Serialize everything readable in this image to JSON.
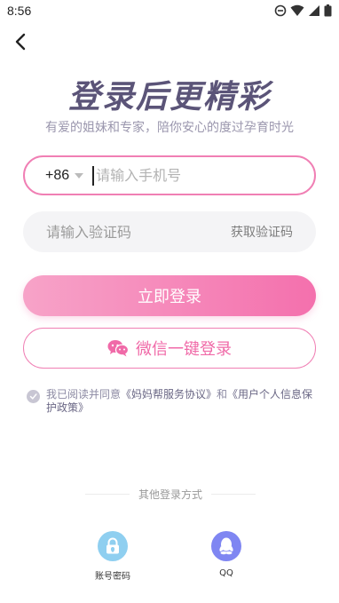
{
  "status_bar": {
    "time": "8:56"
  },
  "hero": {
    "title": "登录后更精彩",
    "subtitle": "有爱的姐妹和专家，陪你安心的度过孕育时光"
  },
  "phone": {
    "country_code": "+86",
    "placeholder": "请输入手机号",
    "value": ""
  },
  "code": {
    "placeholder": "请输入验证码",
    "value": "",
    "get_code_label": "获取验证码"
  },
  "login_button": {
    "label": "立即登录"
  },
  "wechat_button": {
    "label": "微信一键登录"
  },
  "agreement": {
    "prefix": "我已阅读并同意",
    "service_link": "《妈妈帮服务协议》",
    "and": "和",
    "privacy_link": "《用户个人信息保护政策》"
  },
  "alt_login": {
    "title": "其他登录方式",
    "options": [
      {
        "label": "账号密码",
        "icon": "lock-icon"
      },
      {
        "label": "QQ",
        "icon": "qq-icon"
      }
    ]
  },
  "colors": {
    "accent": "#f07fb4",
    "title": "#5b5478",
    "qq": "#7f86f2",
    "account": "#8fcff0"
  }
}
